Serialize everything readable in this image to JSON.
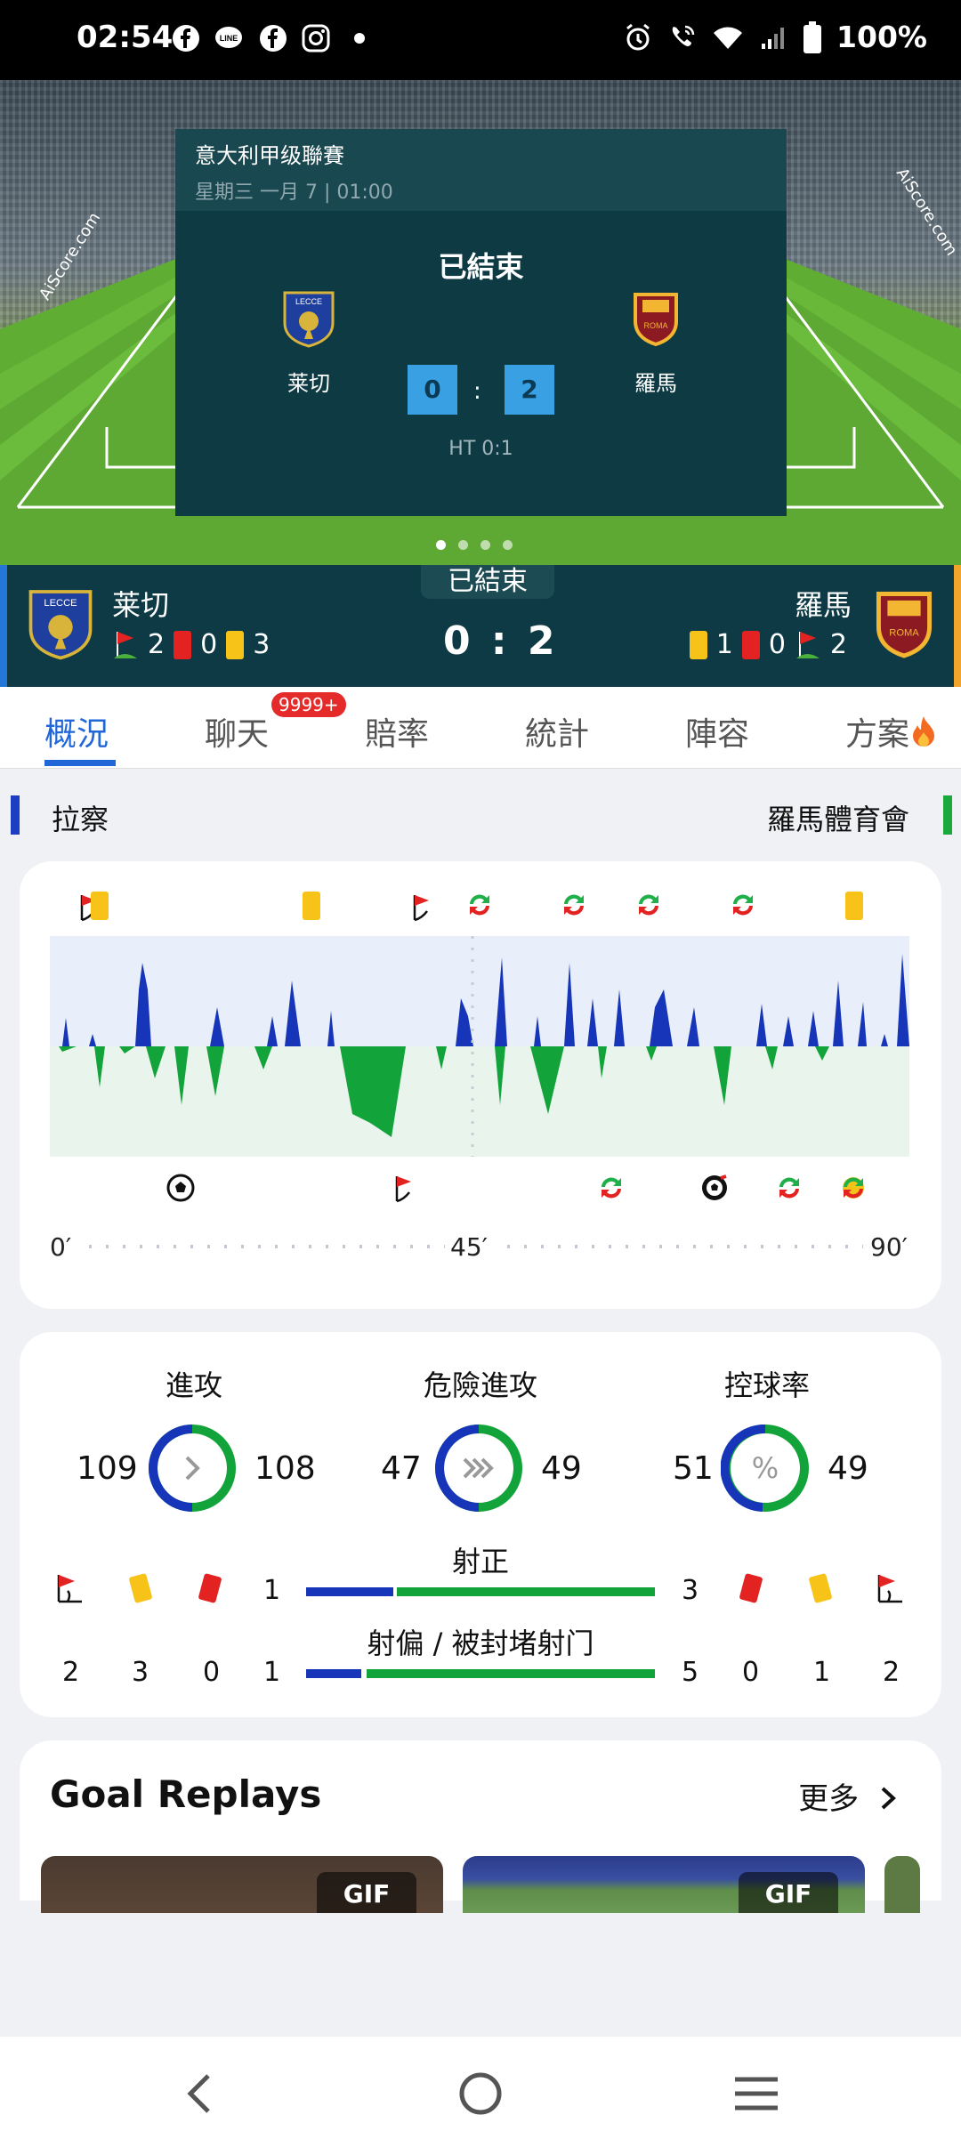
{
  "status_bar": {
    "time": "02:54",
    "battery": "100%"
  },
  "hero": {
    "league": "意大利甲级聯賽",
    "date": "星期三 一月 7 | 01:00",
    "status": "已結束",
    "home_team": "莱切",
    "away_team": "羅馬",
    "home_score": "0",
    "away_score": "2",
    "colon": ":",
    "halftime": "HT 0:1",
    "watermark": "AiScore.com"
  },
  "match_bar": {
    "status": "已結束",
    "home_name": "莱切",
    "away_name": "羅馬",
    "score": "0 : 2",
    "home_stats": {
      "corners": "2",
      "red": "0",
      "yellow": "3"
    },
    "away_stats": {
      "yellow": "1",
      "red": "0",
      "corners": "2"
    }
  },
  "tabs": [
    {
      "label": "概況"
    },
    {
      "label": "聊天"
    },
    {
      "label": "賠率"
    },
    {
      "label": "統計"
    },
    {
      "label": "陣容"
    },
    {
      "label": "方案"
    }
  ],
  "chat_badge": "9999+",
  "team_row": {
    "home": "拉察",
    "away": "羅馬體育會"
  },
  "momentum": {
    "label_start": "0′",
    "label_mid": "45′",
    "label_end": "90′",
    "colors": {
      "home": "#1635b8",
      "away": "#12a43a"
    }
  },
  "stats": {
    "attacks": {
      "title": "進攻",
      "home": "109",
      "away": "108"
    },
    "dangerous": {
      "title": "危險進攻",
      "home": "47",
      "away": "49"
    },
    "possession": {
      "title": "控球率",
      "home": "51",
      "away": "49"
    },
    "on_target": {
      "title": "射正",
      "home": "1",
      "away": "3"
    },
    "off_target": {
      "title": "射偏 / 被封堵射门",
      "home": "1",
      "away": "5"
    },
    "home_counts": {
      "corners": "2",
      "yellow": "3",
      "red": "0"
    },
    "away_counts": {
      "red": "0",
      "yellow": "1",
      "corners": "2"
    }
  },
  "goal_replays": {
    "title": "Goal Replays",
    "more": "更多",
    "gif_label": "GIF"
  }
}
